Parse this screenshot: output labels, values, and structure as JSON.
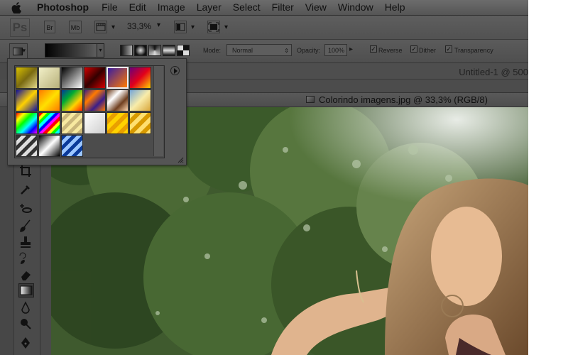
{
  "menubar": {
    "app_name": "Photoshop",
    "items": [
      "File",
      "Edit",
      "Image",
      "Layer",
      "Select",
      "Filter",
      "View",
      "Window",
      "Help"
    ]
  },
  "appbar": {
    "logo": "Ps",
    "bridge": "Br",
    "minibridge": "Mb",
    "zoom": "33,3%"
  },
  "options": {
    "mode_label": "Mode:",
    "mode_value": "Normal",
    "opacity_label": "Opacity:",
    "opacity_value": "100%",
    "reverse_label": "Reverse",
    "dither_label": "Dither",
    "transparency_label": "Transparency",
    "reverse_checked": true,
    "dither_checked": true,
    "transparency_checked": true
  },
  "document": {
    "untitled_tab": "Untitled-1 @ 500",
    "title": "Colorindo imagens.jpg @ 33,3% (RGB/8)"
  },
  "picker": {
    "selected_index": 4,
    "presets": [
      "linear-gradient(135deg,#d8c000,#7a6a10,#e3d88a)",
      "linear-gradient(135deg,#f2f0c8,#b7b07a)",
      "linear-gradient(135deg,#000,#fff)",
      "linear-gradient(135deg,#d40000,#300,#d40000)",
      "linear-gradient(135deg,#3a1da0,#ff7a00)",
      "linear-gradient(135deg,#6a007a,#e2001a,#ffcf00)",
      "linear-gradient(135deg,#1010a0,#ffd200,#1010a0)",
      "linear-gradient(135deg,#ff7a00,#ffe000,#ff7a00)",
      "linear-gradient(135deg,#003a9a,#00aa33,#ffd200,#ff2000)",
      "linear-gradient(135deg,#3a1d8a,#ff7a00,#3a1d8a,#ff7a00)",
      "linear-gradient(135deg,#704020,#fff,#704020,#ffd7b0)",
      "linear-gradient(135deg,#74a6d8,#f8ecaa,#d8a63a)",
      "linear-gradient(135deg,#ff0000,#ffff00,#00ff00,#00ffff,#0000ff,#ff00ff)",
      "repeating-linear-gradient(135deg,#f00 0 4px,#ff0 4px 8px,#0f0 8px 12px,#0ff 12px 16px,#00f 16px 20px,#f0f 20px 24px)",
      "repeating-linear-gradient(135deg,#f7e9a0 0 5px,#c9b67a 5px 10px)",
      "linear-gradient(135deg,#ffffff,#cfcfcf)",
      "repeating-linear-gradient(135deg,#ffd200 0 6px,#e9a000 6px 12px)",
      "repeating-linear-gradient(135deg,#ffe070 0 6px,#d89a00 6px 12px)",
      "repeating-linear-gradient(135deg,#333 0 5px,#ddd 5px 10px)",
      "linear-gradient(135deg,#000,#fff,#000)",
      "repeating-linear-gradient(135deg,#0a3a9a 0 5px,#9dc7ff 5px 10px)"
    ]
  },
  "tools": [
    "crop",
    "eyedropper",
    "spot-healing",
    "brush",
    "clone-stamp",
    "history-brush",
    "eraser",
    "gradient",
    "blur",
    "dodge",
    "pen"
  ],
  "colors": {
    "overlay": "rgba(0,0,0,0.55)",
    "selection_border": "#f0f0f0"
  }
}
